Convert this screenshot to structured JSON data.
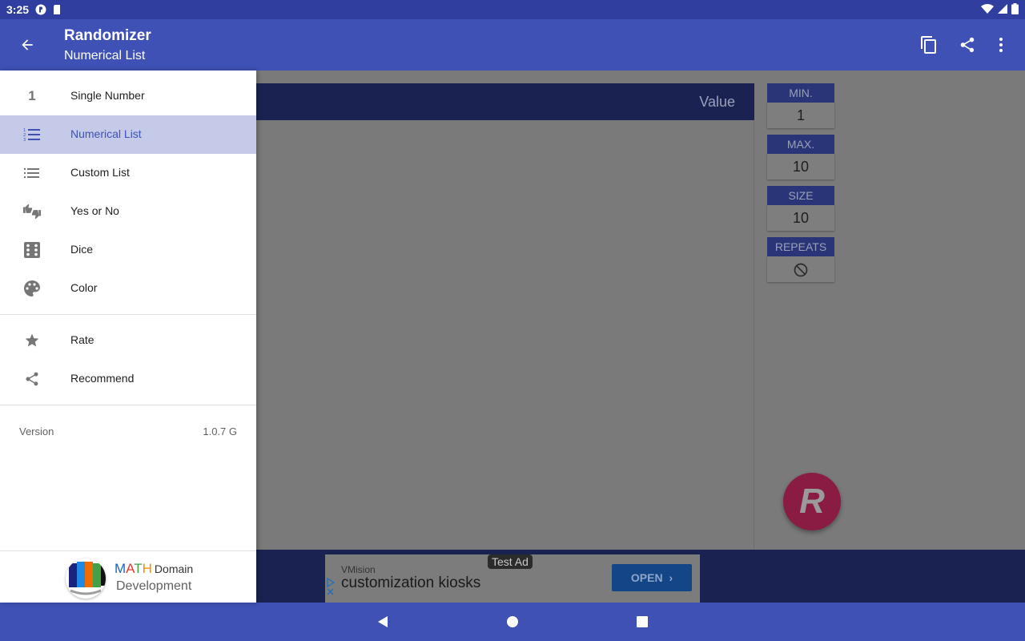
{
  "status_bar": {
    "time": "3:25"
  },
  "app_bar": {
    "title": "Randomizer",
    "subtitle": "Numerical List"
  },
  "content": {
    "table_header": {
      "value_label": "Value"
    },
    "params": [
      {
        "label": "MIN.",
        "value": "1"
      },
      {
        "label": "MAX.",
        "value": "10"
      },
      {
        "label": "SIZE",
        "value": "10"
      },
      {
        "label": "REPEATS",
        "value_icon": "block-icon"
      }
    ],
    "fab_label": "R"
  },
  "ad": {
    "badge": "Test Ad",
    "brand": "VMision",
    "headline": "customization kiosks",
    "open_label": "OPEN"
  },
  "drawer": {
    "items": [
      {
        "label": "Single Number",
        "icon": "one",
        "icon_text": "1",
        "selected": false
      },
      {
        "label": "Numerical List",
        "icon": "numbered-list-icon",
        "selected": true
      },
      {
        "label": "Custom List",
        "icon": "list-icon",
        "selected": false
      },
      {
        "label": "Yes or No",
        "icon": "thumbs-icon",
        "selected": false
      },
      {
        "label": "Dice",
        "icon": "dice-icon",
        "selected": false
      },
      {
        "label": "Color",
        "icon": "palette-icon",
        "selected": false
      }
    ],
    "secondary": [
      {
        "label": "Rate",
        "icon": "star-icon"
      },
      {
        "label": "Recommend",
        "icon": "share-icon"
      }
    ],
    "version_label": "Version",
    "version_value": "1.0.7 G",
    "developer": {
      "m": "M",
      "a": "A",
      "t": "T",
      "h": "H",
      "domain": "Domain",
      "sub": "Development"
    }
  },
  "colors": {
    "primary": "#3f51b5",
    "primary_dark": "#303f9f",
    "selected_bg": "#c5cae9",
    "fab": "#e91e63"
  }
}
